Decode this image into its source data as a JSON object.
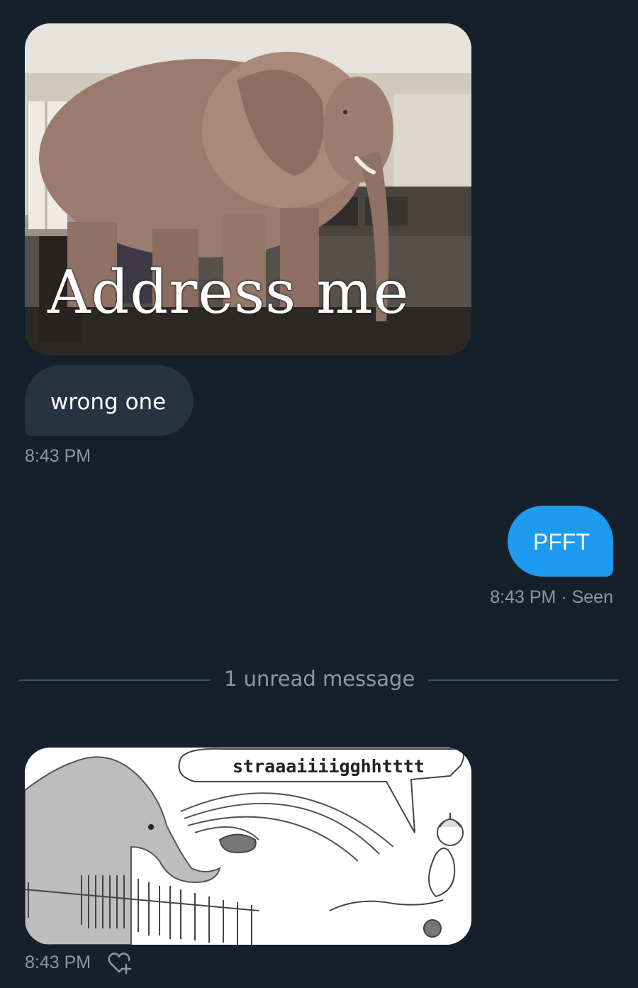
{
  "messages": [
    {
      "type": "image",
      "direction": "incoming",
      "caption": "Address me",
      "depicts": "elephant standing in a room"
    },
    {
      "type": "text",
      "direction": "incoming",
      "text": "wrong one",
      "timestamp": "8:43 PM"
    },
    {
      "type": "text",
      "direction": "outgoing",
      "text": "PFFT",
      "timestamp": "8:43 PM · Seen"
    },
    {
      "type": "image",
      "direction": "incoming",
      "speech": "straaaiiiigghhtttt",
      "depicts": "cartoon of elephant spraying water",
      "timestamp": "8:43 PM"
    }
  ],
  "divider": {
    "label": "1 unread message"
  },
  "icons": {
    "reaction": "heart-plus-icon"
  },
  "colors": {
    "background": "#15202b",
    "incoming_bubble": "#273340",
    "outgoing_bubble": "#1d9bf0",
    "timestamp": "#8b98a5",
    "divider": "#3d5466"
  }
}
